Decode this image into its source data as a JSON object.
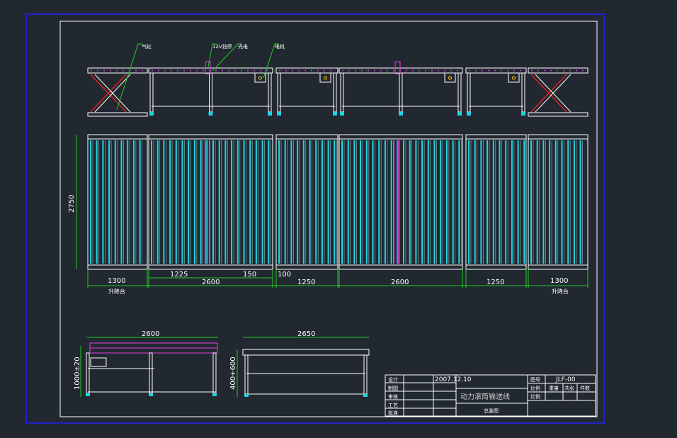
{
  "colors": {
    "background": "#212830",
    "frame_outer": "#2020ff",
    "frame_inner": "#ffffff",
    "roller": "#22d3e6",
    "highlight": "#e040e0",
    "dimension": "#22cc22",
    "callout": "#22cc22",
    "lift": "#e02020"
  },
  "callouts": [
    "气缸",
    "12V挡停",
    "光电",
    "电机"
  ],
  "dimensions": {
    "width": "2750",
    "segments": [
      "1300",
      "2600",
      "1250",
      "2600",
      "1250",
      "1300"
    ],
    "sub": [
      "1225",
      "150",
      "100"
    ],
    "lift_label": "升降台",
    "side_left_length": "2600",
    "side_left_height": "1000±20",
    "side_right_length": "2650",
    "side_right_height": "400+600"
  },
  "title_block": {
    "rows": [
      "设计",
      "制图",
      "审核",
      "工艺",
      "批准"
    ],
    "date": "2007.12.10",
    "title": "动力滚筒输送线",
    "drawing_no_label": "图号",
    "drawing_no": "JLF-00",
    "scale_label": "比例",
    "weight_label": "重量",
    "sheets_label": "共张",
    "qty_label": "件数",
    "scale_label2": "比例",
    "name": "总装图"
  }
}
